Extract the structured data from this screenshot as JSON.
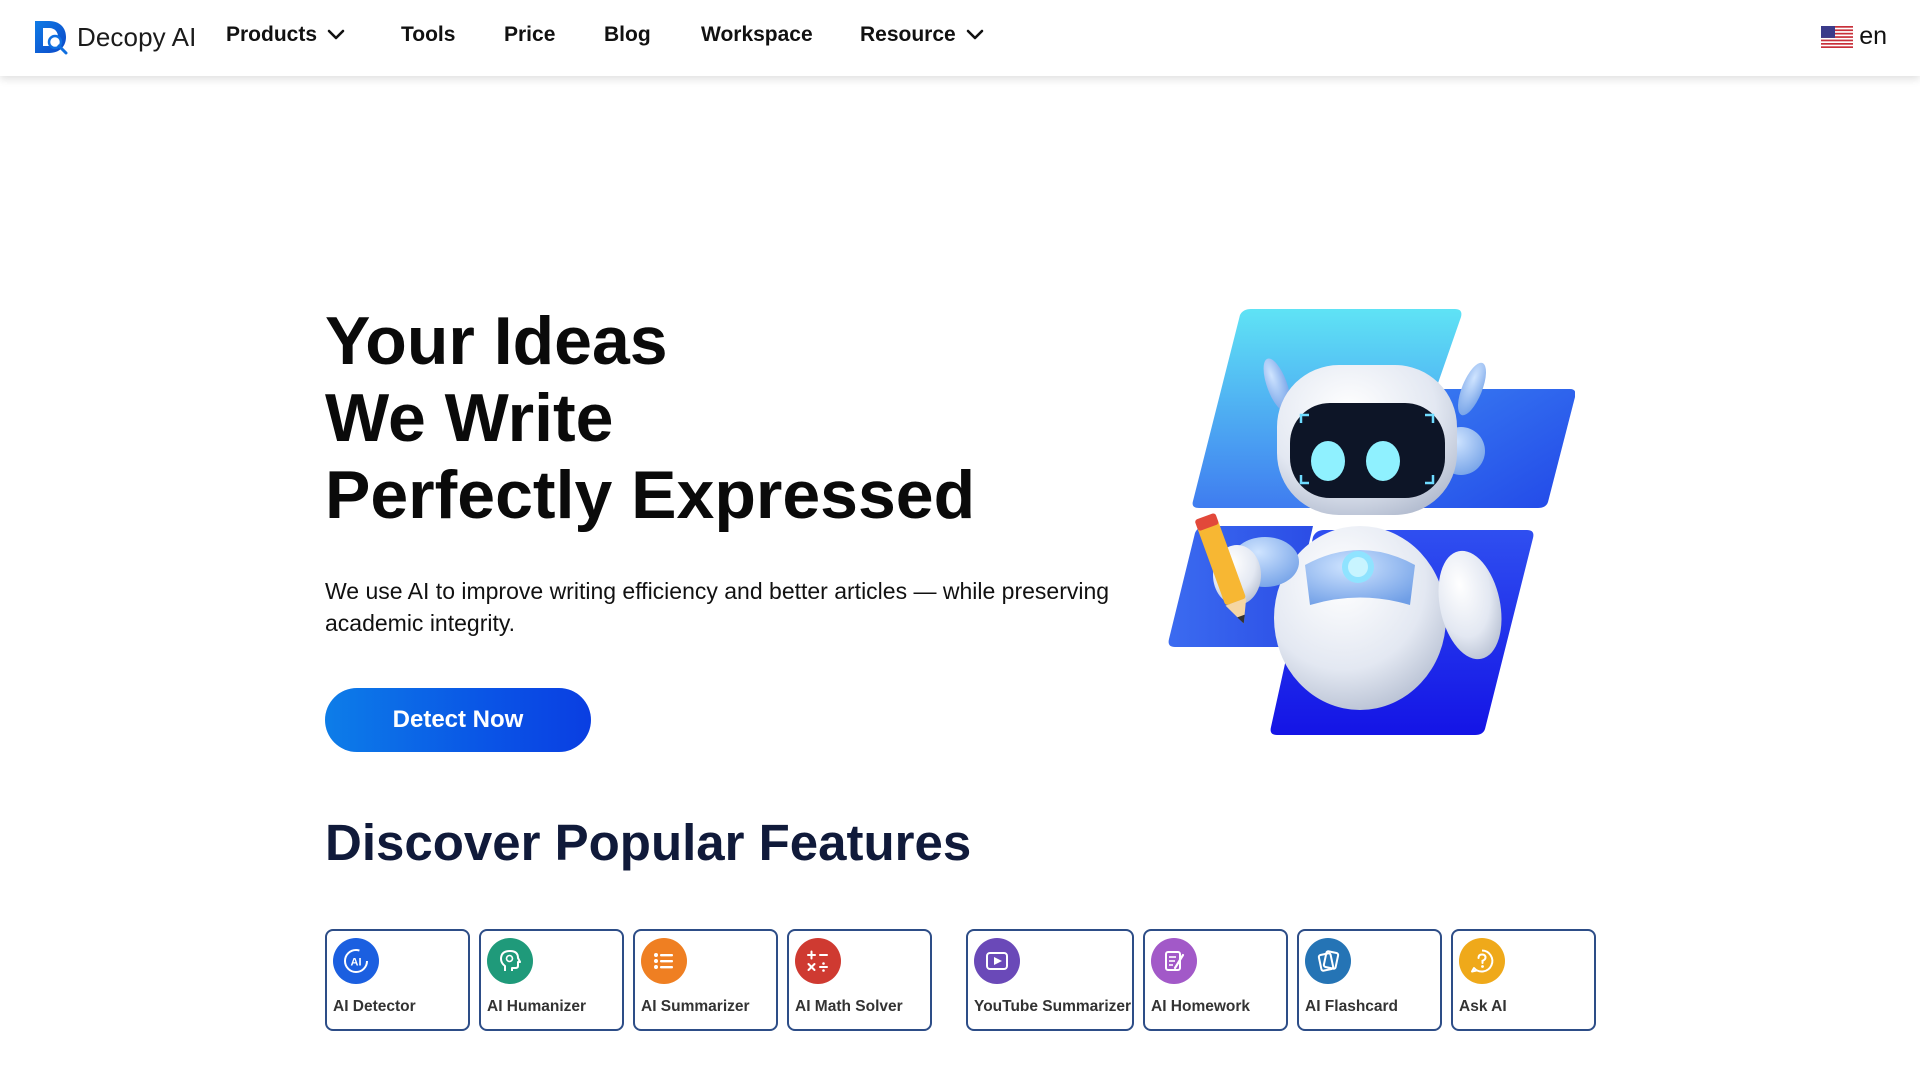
{
  "brand": {
    "name": "Decopy AI"
  },
  "nav": {
    "products": "Products",
    "tools": "Tools",
    "price": "Price",
    "blog": "Blog",
    "workspace": "Workspace",
    "resource": "Resource",
    "language": "en",
    "language_flag_icon": "us-flag-icon"
  },
  "hero": {
    "title_lines": [
      "Your Ideas",
      "We Write",
      "Perfectly Expressed"
    ],
    "subtitle": "We use AI to improve writing efficiency and better articles — while preserving academic integrity.",
    "cta": "Detect Now",
    "illustration_icon": "robot-with-pencil-illustration"
  },
  "features": {
    "title": "Discover Popular Features",
    "cards": [
      {
        "label": "AI Detector",
        "icon": "ai-detector-icon",
        "color": "#1b5fe0"
      },
      {
        "label": "AI Humanizer",
        "icon": "humanizer-head-icon",
        "color": "#1f9a7a"
      },
      {
        "label": "AI Summarizer",
        "icon": "list-icon",
        "color": "#ef7f22"
      },
      {
        "label": "AI Math Solver",
        "icon": "math-operators-icon",
        "color": "#cf3a31"
      },
      {
        "label": "YouTube Summarizer",
        "icon": "play-icon",
        "color": "#6a49b8"
      },
      {
        "label": "AI Homework",
        "icon": "homework-notepad-icon",
        "color": "#a259c8"
      },
      {
        "label": "AI Flashcard",
        "icon": "flashcard-icon",
        "color": "#2574b5"
      },
      {
        "label": "Ask AI",
        "icon": "question-bubble-icon",
        "color": "#efa91a"
      }
    ]
  },
  "colors": {
    "cta_gradient_start": "#0d7de8",
    "cta_gradient_end": "#0a3ee2",
    "feature_title": "#101a3a",
    "card_border": "#2d4d87"
  }
}
